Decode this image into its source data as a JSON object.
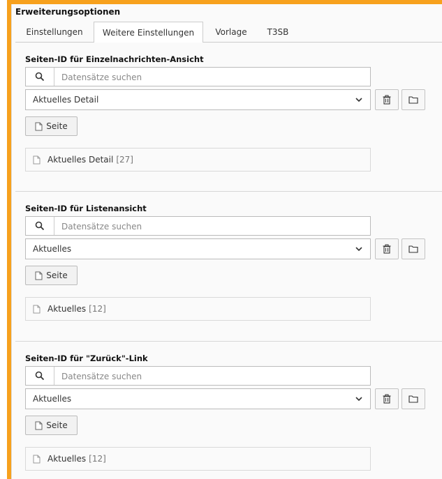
{
  "panel": {
    "title": "Erweiterungsoptionen"
  },
  "tabs": [
    {
      "label": "Einstellungen"
    },
    {
      "label": "Weitere Einstellungen"
    },
    {
      "label": "Vorlage"
    },
    {
      "label": "T3SB"
    }
  ],
  "sections": [
    {
      "title": "Seiten-ID für Einzelnachrichten-Ansicht",
      "search_placeholder": "Datensätze suchen",
      "selected": "Aktuelles Detail",
      "page_button": "Seite",
      "item": {
        "name": "Aktuelles Detail",
        "uid": "[27]"
      }
    },
    {
      "title": "Seiten-ID für Listenansicht",
      "search_placeholder": "Datensätze suchen",
      "selected": "Aktuelles",
      "page_button": "Seite",
      "item": {
        "name": "Aktuelles",
        "uid": "[12]"
      }
    },
    {
      "title": "Seiten-ID für \"Zurück\"-Link",
      "search_placeholder": "Datensätze suchen",
      "selected": "Aktuelles",
      "page_button": "Seite",
      "item": {
        "name": "Aktuelles",
        "uid": "[12]"
      }
    }
  ],
  "colors": {
    "accent": "#f7a11d"
  }
}
